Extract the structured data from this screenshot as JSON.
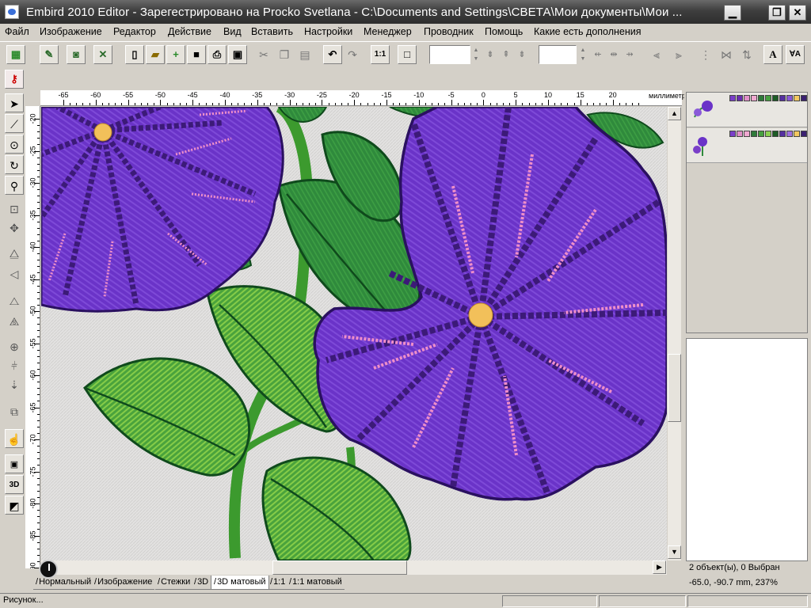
{
  "window": {
    "title": "Embird 2010 Editor - Зарегестрировано на Procko Svetlana - C:\\Documents and Settings\\СВЕТА\\Мои документы\\Мои ...",
    "minimize": "▁",
    "maximize": "❐",
    "close": "✕"
  },
  "menu": {
    "items": [
      "Файл",
      "Изображение",
      "Редактор",
      "Действие",
      "Вид",
      "Вставить",
      "Настройки",
      "Менеджер",
      "Проводник",
      "Помощь",
      "Какие есть дополнения"
    ]
  },
  "toolbar": {
    "zoom_one_to_one": "1:1",
    "text_tool": "A",
    "text_tool_alt": "ⱯA",
    "value_field_1": "",
    "value_field_2": ""
  },
  "ruler": {
    "unit": "миллиметр",
    "top_labels": [
      "-65",
      "-60",
      "-55",
      "-50",
      "-45",
      "-40",
      "-35",
      "-30",
      "-25",
      "-20",
      "-15",
      "-10",
      "-5",
      "0",
      "5",
      "10",
      "15",
      "20"
    ],
    "left_labels": [
      "-20",
      "-25",
      "-30",
      "-35",
      "-40",
      "-45",
      "-50",
      "-55",
      "-60",
      "-65",
      "-70",
      "-75",
      "-80",
      "-85",
      "-90"
    ]
  },
  "view_tabs": [
    "Нормальный",
    "Изображение",
    "Стежки",
    "3D",
    "3D матовый",
    "1:1",
    "1:1 матовый"
  ],
  "active_tab": "3D матовый",
  "objects": [
    {
      "swatches": [
        "#7a3fc8",
        "#6a2fb0",
        "#e08fc8",
        "#f0a8d0",
        "#2e7a3a",
        "#46a040",
        "#1d5c26",
        "#5530a0",
        "#8a5ad8",
        "#f2c860",
        "#3a2070"
      ]
    },
    {
      "swatches": [
        "#7a3fc8",
        "#e08fc8",
        "#f0a8d0",
        "#2e7a3a",
        "#46a040",
        "#8ad050",
        "#1d5c26",
        "#5530a0",
        "#a070e0",
        "#f2c860",
        "#3a2070"
      ]
    }
  ],
  "info": {
    "selection": "2 объект(ы), 0 Выбран",
    "coords": "-65.0, -90.7 mm, 237%"
  },
  "status": {
    "text": "Рисунок..."
  },
  "icons": {
    "left_tools": [
      "arrow-select-icon",
      "lasso-select-icon",
      "freehand-select-icon",
      "rotate-icon",
      "zoom-icon",
      "crop-icon",
      "move-icon",
      "mirror-icon",
      "mirror-vertical-icon",
      "skew-icon",
      "skew-vertical-icon",
      "center-icon",
      "align-icon",
      "distribute-icon",
      "arrange-icon",
      "hand-icon",
      "box-icon",
      "3d-icon",
      "mask-icon"
    ]
  },
  "colors": {
    "petal": "#6a33c8",
    "petal_dark": "#3c1a78",
    "pink": "#f08fc8",
    "leaf": "#2f8a3c",
    "leaf_light": "#7cc64a",
    "center": "#f2c05a",
    "fabric": "#e3e2e1"
  }
}
